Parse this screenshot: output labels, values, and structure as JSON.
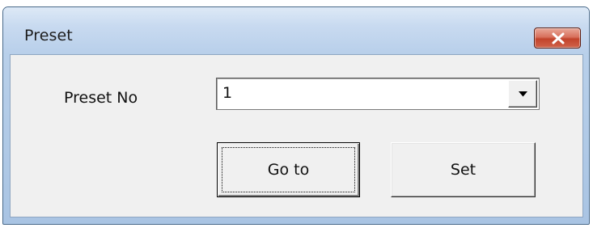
{
  "window": {
    "title": "Preset",
    "close_icon": "close-icon"
  },
  "form": {
    "preset_label": "Preset No",
    "preset_value": "1",
    "dropdown_icon": "chevron-down-icon"
  },
  "buttons": {
    "goto_label": "Go to",
    "set_label": "Set"
  },
  "colors": {
    "client_bg": "#f0f0f0",
    "titlebar": "#c8daf0",
    "close_red": "#c2432b"
  }
}
